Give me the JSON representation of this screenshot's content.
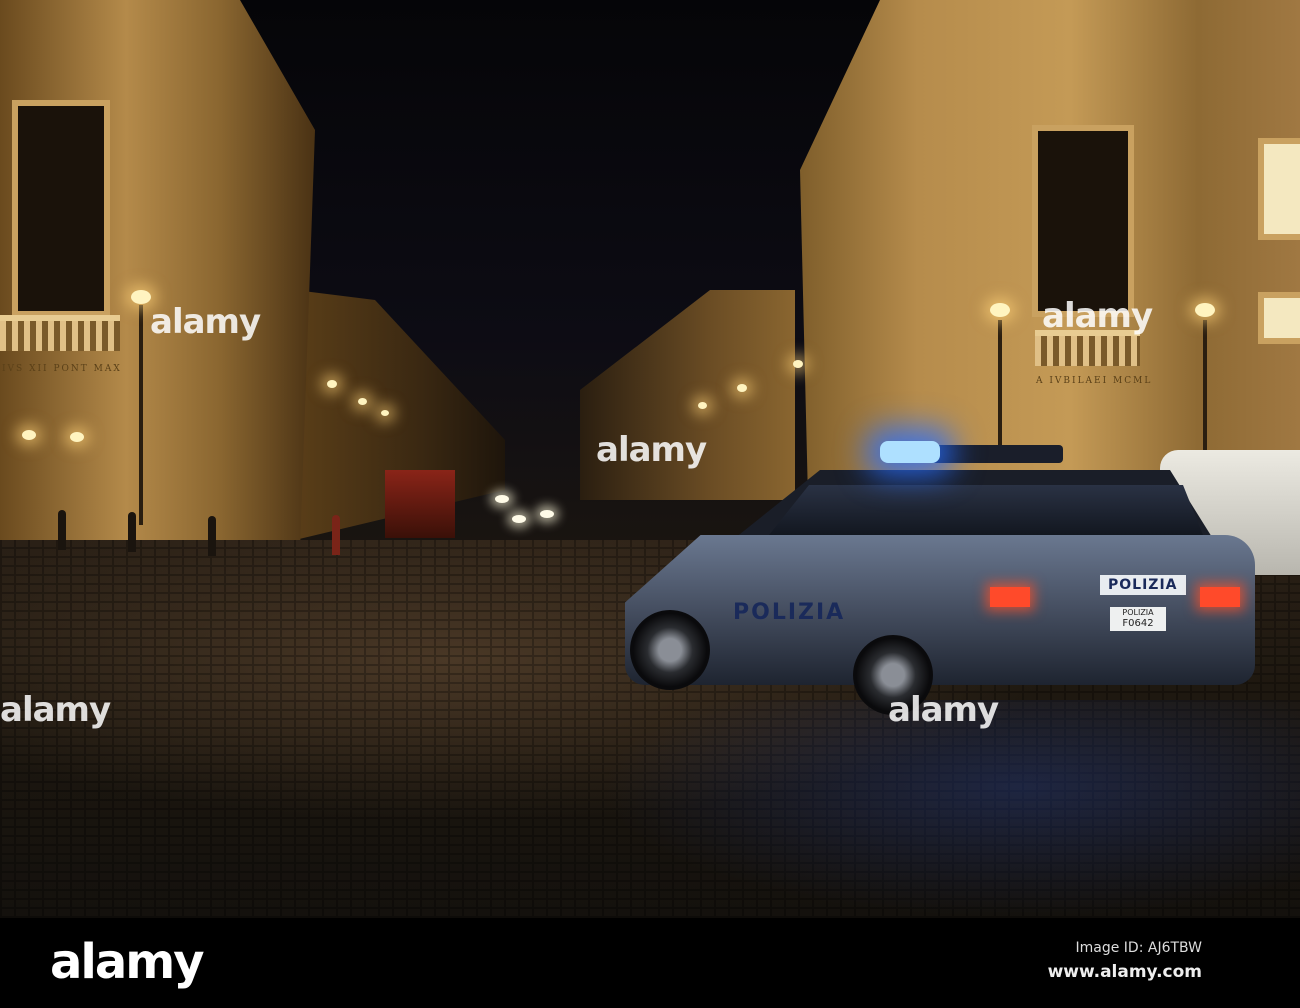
{
  "photo": {
    "subject": "Polizia car at night in a Rome street",
    "car_side_text": "POLIZIA",
    "car_rear_text": "POLIZIA",
    "plate_top": "POLIZIA",
    "plate_number": "F0642",
    "inscription_left": "IVS XII PONT MAX",
    "inscription_right": "A IVBILAEI MCML"
  },
  "watermark": {
    "text": "alamy",
    "overlay_text": "alamy"
  },
  "footer": {
    "logo": "alamy",
    "image_id": "Image ID: AJ6TBW",
    "url": "www.alamy.com"
  }
}
